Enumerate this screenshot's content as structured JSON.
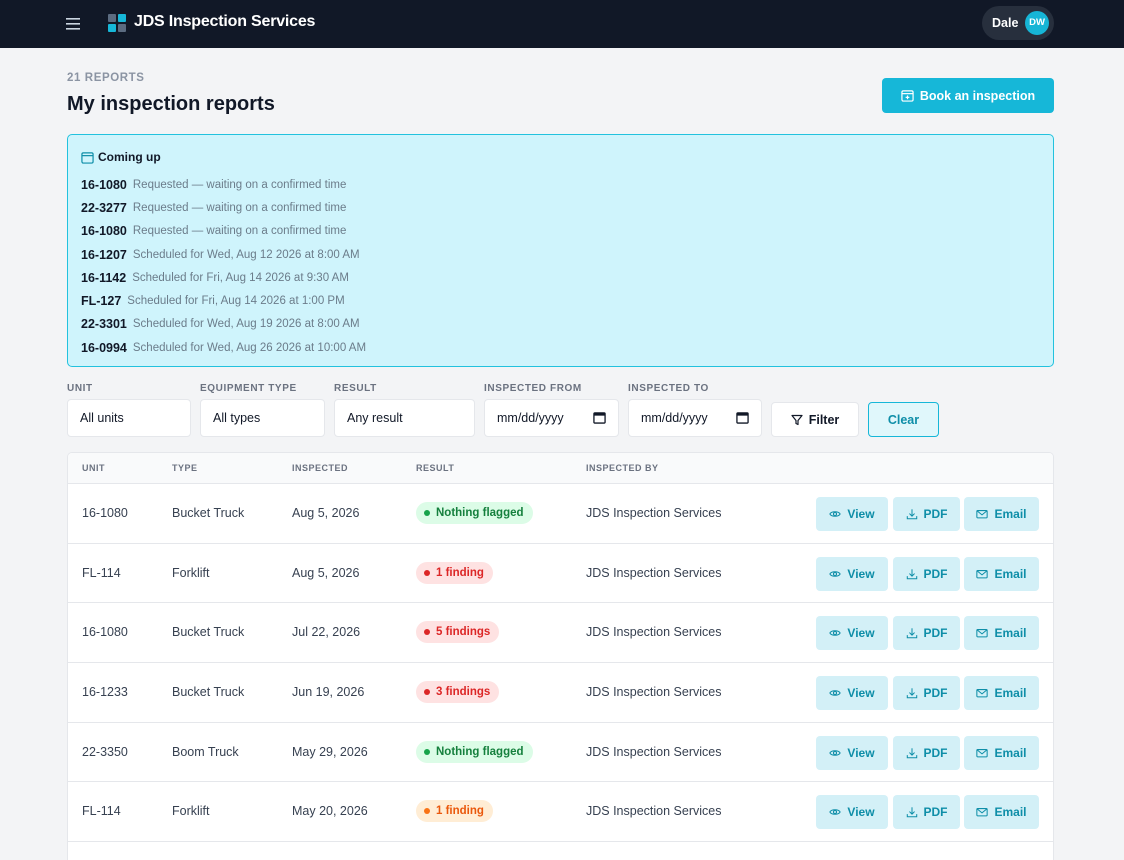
{
  "topbar": {
    "brand": "JDS Inspection Services",
    "user_name": "Dale",
    "avatar_initials": "DW",
    "logo_colors": [
      "#5b6b80",
      "#16b7d8",
      "#16b7d8",
      "#5b6b80"
    ]
  },
  "header": {
    "count_label": "21 REPORTS",
    "title": "My inspection reports",
    "book_button": "Book an inspection"
  },
  "coming_up": {
    "title": "Coming up",
    "items": [
      {
        "unit": "16-1080",
        "text": "Requested — waiting on a confirmed time"
      },
      {
        "unit": "22-3277",
        "text": "Requested — waiting on a confirmed time"
      },
      {
        "unit": "16-1080",
        "text": "Requested — waiting on a confirmed time"
      },
      {
        "unit": "16-1207",
        "text": "Scheduled for Wed, Aug 12 2026 at 8:00 AM"
      },
      {
        "unit": "16-1142",
        "text": "Scheduled for Fri, Aug 14 2026 at 9:30 AM"
      },
      {
        "unit": "FL-127",
        "text": "Scheduled for Fri, Aug 14 2026 at 1:00 PM"
      },
      {
        "unit": "22-3301",
        "text": "Scheduled for Wed, Aug 19 2026 at 8:00 AM"
      },
      {
        "unit": "16-0994",
        "text": "Scheduled for Wed, Aug 26 2026 at 10:00 AM"
      }
    ]
  },
  "filters": {
    "unit_label": "UNIT",
    "unit_value": "All units",
    "equipment_label": "EQUIPMENT TYPE",
    "equipment_value": "All types",
    "result_label": "RESULT",
    "result_value": "Any result",
    "from_label": "INSPECTED FROM",
    "from_placeholder": "mm/dd/yyyy",
    "to_label": "INSPECTED TO",
    "to_placeholder": "mm/dd/yyyy",
    "filter_button": "Filter",
    "clear_button": "Clear"
  },
  "table": {
    "columns": [
      "UNIT",
      "TYPE",
      "INSPECTED",
      "RESULT",
      "INSPECTED BY"
    ],
    "actions": {
      "view": "View",
      "pdf": "PDF",
      "email": "Email"
    },
    "rows": [
      {
        "unit": "16-1080",
        "type": "Bucket Truck",
        "inspected": "Aug 5, 2026",
        "result": "Nothing flagged",
        "status": "ok",
        "by": "JDS Inspection Services"
      },
      {
        "unit": "FL-114",
        "type": "Forklift",
        "inspected": "Aug 5, 2026",
        "result": "1 finding",
        "status": "critical",
        "by": "JDS Inspection Services"
      },
      {
        "unit": "16-1080",
        "type": "Bucket Truck",
        "inspected": "Jul 22, 2026",
        "result": "5 findings",
        "status": "critical",
        "by": "JDS Inspection Services"
      },
      {
        "unit": "16-1233",
        "type": "Bucket Truck",
        "inspected": "Jun 19, 2026",
        "result": "3 findings",
        "status": "critical",
        "by": "JDS Inspection Services"
      },
      {
        "unit": "22-3350",
        "type": "Boom Truck",
        "inspected": "May 29, 2026",
        "result": "Nothing flagged",
        "status": "ok",
        "by": "JDS Inspection Services"
      },
      {
        "unit": "FL-114",
        "type": "Forklift",
        "inspected": "May 20, 2026",
        "result": "1 finding",
        "status": "warning",
        "by": "JDS Inspection Services"
      }
    ]
  },
  "colors": {
    "accent": "#16b7d8",
    "ok_bg": "#dcfce7",
    "ok_fg": "#15803d",
    "ok_dot": "#16a34a",
    "critical_bg": "#fee2e2",
    "critical_fg": "#dc2626",
    "critical_dot": "#dc2626",
    "warning_bg": "#ffedd5",
    "warning_fg": "#ea580c",
    "warning_dot": "#f97316"
  }
}
